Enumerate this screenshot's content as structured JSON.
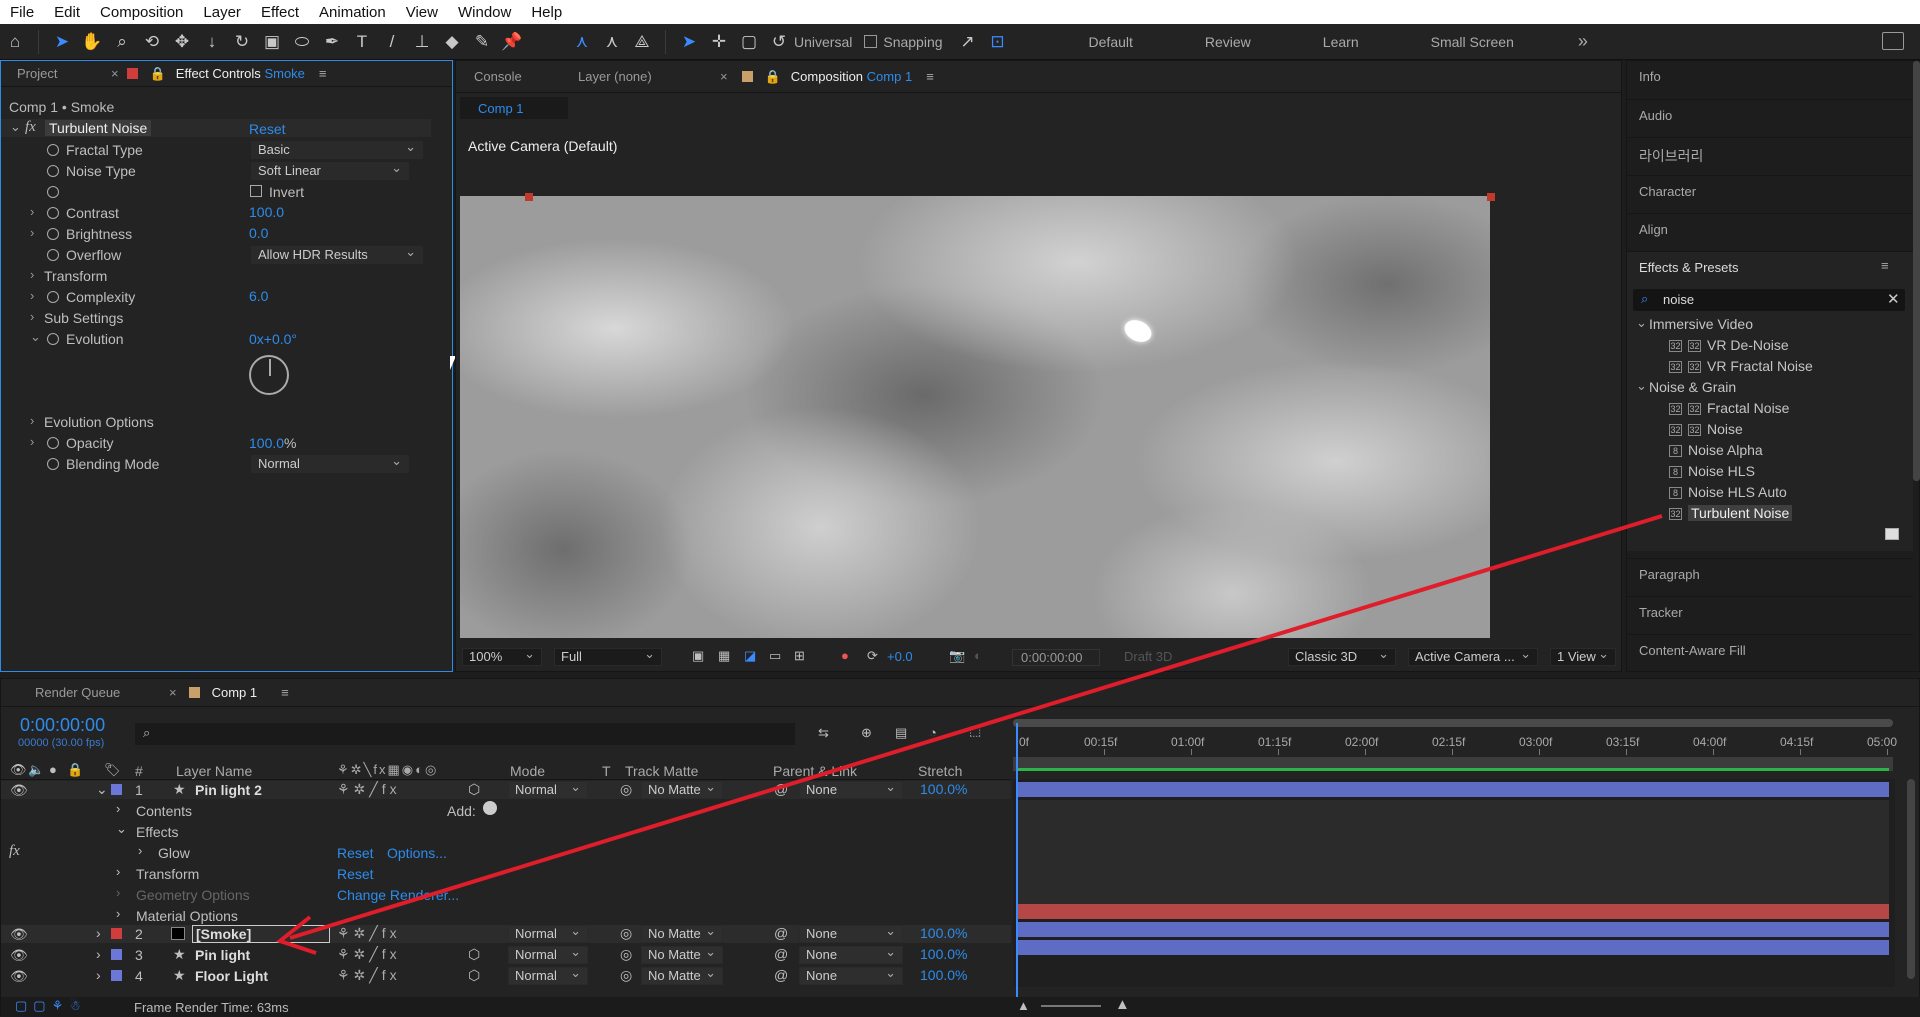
{
  "menu": [
    "File",
    "Edit",
    "Composition",
    "Layer",
    "Effect",
    "Animation",
    "View",
    "Window",
    "Help"
  ],
  "toolbar": {
    "universal": "Universal",
    "snapping": "Snapping",
    "workspaces": [
      "Default",
      "Review",
      "Learn",
      "Small Screen"
    ]
  },
  "effect_controls": {
    "tabs": {
      "project": "Project",
      "ec_prefix": "Effect Controls",
      "ec_layer": "Smoke"
    },
    "breadcrumb": "Comp 1 • Smoke",
    "effect_name": "Turbulent Noise",
    "reset": "Reset",
    "props": {
      "fractal_type": "Fractal Type",
      "fractal_type_val": "Basic",
      "noise_type": "Noise Type",
      "noise_type_val": "Soft Linear",
      "invert": "Invert",
      "contrast": "Contrast",
      "contrast_val": "100.0",
      "brightness": "Brightness",
      "brightness_val": "0.0",
      "overflow": "Overflow",
      "overflow_val": "Allow HDR Results",
      "transform": "Transform",
      "complexity": "Complexity",
      "complexity_val": "6.0",
      "sub_settings": "Sub Settings",
      "evolution": "Evolution",
      "evolution_val": "0x+0.0°",
      "evolution_options": "Evolution Options",
      "opacity": "Opacity",
      "opacity_val": "100.0",
      "opacity_unit": "%",
      "blending_mode": "Blending Mode",
      "blending_mode_val": "Normal"
    }
  },
  "viewer": {
    "tabs": {
      "console": "Console",
      "layer": "Layer (none)",
      "comp_prefix": "Composition",
      "comp_name": "Comp 1"
    },
    "subtab": "Comp 1",
    "camera_label": "Active Camera (Default)",
    "footer": {
      "zoom": "100%",
      "quality": "Full",
      "exposure": "+0.0",
      "timecode": "0:00:00:00",
      "draft": "Draft 3D",
      "renderer": "Classic 3D",
      "camera": "Active Camera ...",
      "views": "1 View"
    }
  },
  "right_panel": {
    "top_items": [
      "Info",
      "Audio",
      "라이브러리",
      "Character",
      "Align"
    ],
    "effects_title": "Effects & Presets",
    "search_value": "noise",
    "groups": [
      {
        "name": "Immersive Video",
        "items": [
          "VR De-Noise",
          "VR Fractal Noise"
        ]
      },
      {
        "name": "Noise & Grain",
        "items": [
          "Fractal Noise",
          "Noise",
          "Noise Alpha",
          "Noise HLS",
          "Noise HLS Auto",
          "Turbulent Noise"
        ]
      }
    ],
    "bottom_items": [
      "Paragraph",
      "Tracker",
      "Content-Aware Fill"
    ]
  },
  "timeline": {
    "tabs": {
      "render_queue": "Render Queue",
      "comp": "Comp 1"
    },
    "timecode": "0:00:00:00",
    "fps": "00000 (30.00 fps)",
    "headers": {
      "num": "#",
      "layer_name": "Layer Name",
      "mode": "Mode",
      "t": "T",
      "track_matte": "Track Matte",
      "parent": "Parent & Link",
      "stretch": "Stretch"
    },
    "ruler": [
      "0f",
      "00:15f",
      "01:00f",
      "01:15f",
      "02:00f",
      "02:15f",
      "03:00f",
      "03:15f",
      "04:00f",
      "04:15f",
      "05:00"
    ],
    "layer1": {
      "num": "1",
      "name": "Pin light 2",
      "mode": "Normal",
      "matte": "No Matte",
      "parent": "None",
      "stretch": "100.0%"
    },
    "sub": {
      "contents": "Contents",
      "add": "Add:",
      "effects": "Effects",
      "glow": "Glow",
      "reset": "Reset",
      "options": "Options...",
      "transform": "Transform",
      "reset2": "Reset",
      "geometry": "Geometry Options",
      "change_renderer": "Change Renderer...",
      "material": "Material Options"
    },
    "layers": [
      {
        "num": "2",
        "name": "[Smoke]",
        "mode": "Normal",
        "matte": "No Matte",
        "parent": "None",
        "stretch": "100.0%",
        "color": "#d13d3d"
      },
      {
        "num": "3",
        "name": "Pin light",
        "mode": "Normal",
        "matte": "No Matte",
        "parent": "None",
        "stretch": "100.0%",
        "color": "#6b78d8"
      },
      {
        "num": "4",
        "name": "Floor Light",
        "mode": "Normal",
        "matte": "No Matte",
        "parent": "None",
        "stretch": "100.0%",
        "color": "#6b78d8"
      }
    ],
    "status": "Frame Render Time: 63ms"
  }
}
